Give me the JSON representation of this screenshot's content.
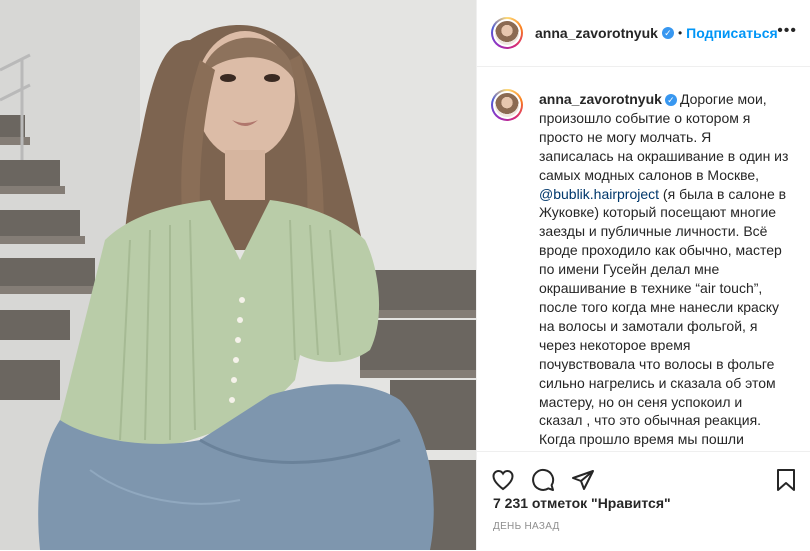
{
  "post": {
    "username": "anna_zavorotnyuk",
    "separator": "•",
    "follow_label": "Подписаться",
    "more_label": "•••"
  },
  "caption": {
    "username": "anna_zavorotnyuk",
    "text_before_link": "Дорогие мои, произошло событие о котором я просто не могу молчать. Я записалась на окрашивание в один из самых модных салонов в Москве, ",
    "mention": "@bublik.hairproject",
    "text_after_link": " (я была в салоне в Жуковке) который посещают многие заезды и публичные личности. Всё вроде проходило как обычно, мастер по имени Гусейн делал мне окрашивание в технике “air touch”, после того когда мне нанесли краску на волосы и замотали фольгой, я через некоторое время почувствовала что волосы в фольге сильно нагрелись и сказала об этом мастеру, но он сеня успокоил и сказал , что это обычная реакция. Когда прошло время мы пошли смывать меня в Мойке, а"
  },
  "actions": {
    "like": "heart-icon",
    "comment": "comment-icon",
    "share": "share-icon",
    "save": "bookmark-icon"
  },
  "likes": "7 231 отметок \"Нравится\"",
  "time_ago": "ДЕНЬ НАЗАД",
  "colors": {
    "accent": "#0095f6",
    "verified": "#3897f0",
    "text": "#262626",
    "muted": "#8e8e8e"
  }
}
